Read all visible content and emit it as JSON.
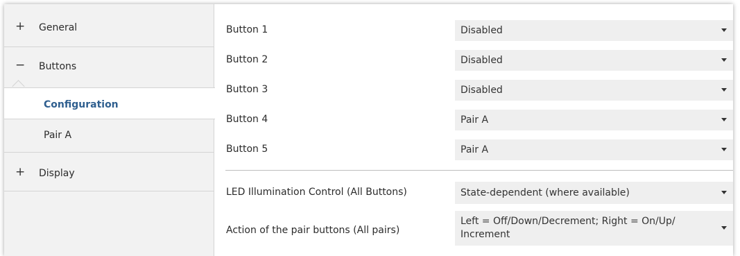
{
  "sidebar": {
    "items": [
      {
        "sign": "+",
        "label": "General"
      },
      {
        "sign": "−",
        "label": "Buttons"
      },
      {
        "sign": "+",
        "label": "Display"
      }
    ],
    "sub_items": [
      {
        "label": "Configuration",
        "active": true
      },
      {
        "label": "Pair A",
        "active": false
      }
    ]
  },
  "form": {
    "rows": [
      {
        "label": "Button 1",
        "value": "Disabled"
      },
      {
        "label": "Button 2",
        "value": "Disabled"
      },
      {
        "label": "Button 3",
        "value": "Disabled"
      },
      {
        "label": "Button 4",
        "value": "Pair A"
      },
      {
        "label": "Button 5",
        "value": "Pair A"
      }
    ],
    "options": [
      {
        "label": "LED Illumination Control (All Buttons)",
        "value": "State-dependent (where available)"
      },
      {
        "label": "Action of the pair buttons (All pairs)",
        "value": "Left = Off/Down/Decrement; Right = On/Up/ Increment"
      }
    ]
  },
  "colors": {
    "sidebar_bg": "#f2f2f2",
    "select_bg": "#efefef",
    "active_text": "#2f5f8f"
  }
}
